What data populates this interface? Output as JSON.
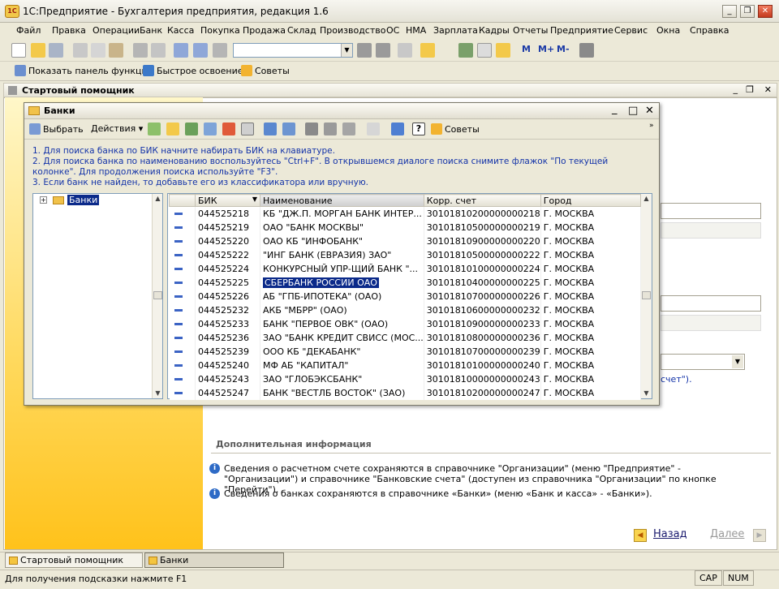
{
  "window": {
    "title": "1С:Предприятие - Бухгалтерия предприятия, редакция 1.6",
    "logo": "1С"
  },
  "menu": [
    "Файл",
    "Правка",
    "Операции",
    "Банк",
    "Касса",
    "Покупка",
    "Продажа",
    "Склад",
    "Производство",
    "ОС",
    "НМА",
    "Зарплата",
    "Кадры",
    "Отчеты",
    "Предприятие",
    "Сервис",
    "Окна",
    "Справка"
  ],
  "toolbar": {
    "search_value": "",
    "m_buttons": [
      "M",
      "M+",
      "M-"
    ]
  },
  "funcbar": {
    "show_panel": "Показать панель функций",
    "quick": "Быстрое освоение",
    "tips": "Советы"
  },
  "panel": {
    "title": "Стартовый помощник"
  },
  "banks_window": {
    "title": "Банки",
    "select": "Выбрать",
    "actions": "Действия",
    "tips": "Советы",
    "help": [
      "1. Для поиска банка по БИК начните набирать БИК на клавиатуре.",
      "2. Для поиска банка по наименованию воспользуйтесь \"Ctrl+F\". В открывшемся диалоге поиска снимите флажок \"По текущей колонке\". Для продолжения поиска используйте \"F3\".",
      "3. Если банк не найден, то добавьте его из классификатора или вручную."
    ],
    "tree_root": "Банки",
    "columns": [
      "БИК",
      "Наименование",
      "Корр. счет",
      "Город"
    ],
    "rows": [
      [
        "044525218",
        "КБ \"ДЖ.П. МОРГАН БАНК ИНТЕР...",
        "30101810200000000218",
        "Г. МОСКВА"
      ],
      [
        "044525219",
        "ОАО \"БАНК МОСКВЫ\"",
        "30101810500000000219",
        "Г. МОСКВА"
      ],
      [
        "044525220",
        "ОАО КБ \"ИНФОБАНК\"",
        "30101810900000000220",
        "Г. МОСКВА"
      ],
      [
        "044525222",
        "\"ИНГ БАНК (ЕВРАЗИЯ) ЗАО\"",
        "30101810500000000222",
        "Г. МОСКВА"
      ],
      [
        "044525224",
        "КОНКУРСНЫЙ УПР-ЩИЙ БАНК \"...",
        "30101810100000000224",
        "Г. МОСКВА"
      ],
      [
        "044525225",
        "СБЕРБАНК РОССИИ ОАО",
        "30101810400000000225",
        "Г. МОСКВА"
      ],
      [
        "044525226",
        "АБ \"ГПБ-ИПОТЕКА\" (ОАО)",
        "30101810700000000226",
        "Г. МОСКВА"
      ],
      [
        "044525232",
        "АКБ \"МБРР\" (ОАО)",
        "30101810600000000232",
        "Г. МОСКВА"
      ],
      [
        "044525233",
        "БАНК \"ПЕРВОЕ ОВК\" (ОАО)",
        "30101810900000000233",
        "Г. МОСКВА"
      ],
      [
        "044525236",
        "ЗАО \"БАНК КРЕДИТ СВИСС (МОС...",
        "30101810800000000236",
        "Г. МОСКВА"
      ],
      [
        "044525239",
        "ООО КБ \"ДЕКАБАНК\"",
        "30101810700000000239",
        "Г. МОСКВА"
      ],
      [
        "044525240",
        "МФ АБ \"КАПИТАЛ\"",
        "30101810100000000240",
        "Г. МОСКВА"
      ],
      [
        "044525243",
        "ЗАО \"ГЛОБЭКСБАНК\"",
        "30101810000000000243",
        "Г. МОСКВА"
      ],
      [
        "044525247",
        "БАНК \"ВЕСТЛБ ВОСТОК\" (ЗАО)",
        "30101810200000000247",
        "Г. МОСКВА"
      ]
    ],
    "selected_index": 5
  },
  "assistant": {
    "fragment": "счет\").",
    "section_title": "Дополнительная информация",
    "info": [
      "Сведения о расчетном счете сохраняются в справочнике \"Организации\" (меню \"Предприятие\" - \"Организации\") и справочнике \"Банковские счета\" (доступен из справочника \"Организации\" по кнопке \"Перейти\").",
      "Сведения о банках сохраняются в справочнике «Банки» (меню «Банк и касса» - «Банки»)."
    ],
    "back": "Назад",
    "next": "Далее"
  },
  "taskbar": [
    "Стартовый помощник",
    "Банки"
  ],
  "status": {
    "text": "Для получения подсказки нажмите F1",
    "cap": "CAP",
    "num": "NUM"
  }
}
